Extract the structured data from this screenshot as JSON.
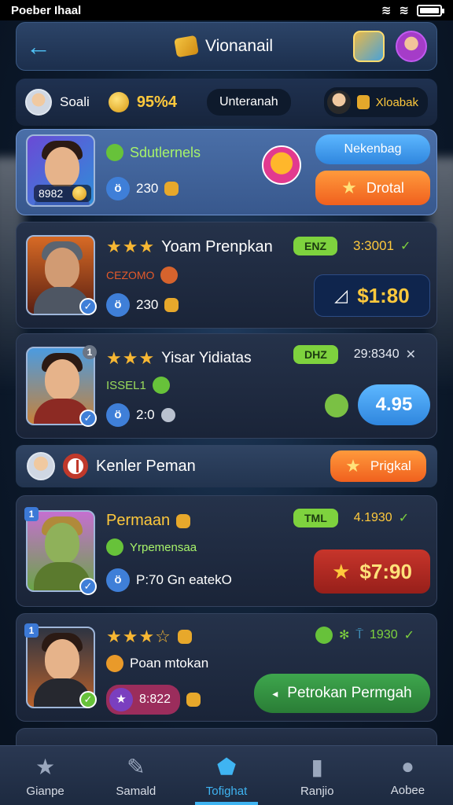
{
  "status_bar": {
    "carrier": "Poeber Ihaal"
  },
  "header": {
    "title": "Vionanail"
  },
  "filter_row": {
    "label": "Soali",
    "score": "95%4",
    "tab": "Unteranah",
    "user_label": "Xloabak"
  },
  "featured": {
    "rating": "Sdutlernels",
    "count": "230",
    "id": "8982",
    "btn_top": "Nekenbag",
    "btn_bottom": "Drotal"
  },
  "cards": [
    {
      "stars": "★★★",
      "title": "Yoam Prenpkan",
      "tag": "ENZ",
      "meta": "3:3001",
      "sub": "CEZOMO",
      "count": "230",
      "price": "$1:80"
    },
    {
      "stars": "★★★",
      "title": "Yisar Yidiatas",
      "tag": "DHZ",
      "meta": "29:8340",
      "sub": "ISSEL1",
      "count": "2:0",
      "price": "4.95"
    }
  ],
  "divider": {
    "label": "Kenler Peman",
    "button": "Prigkal"
  },
  "card3": {
    "title": "Permaan",
    "tag": "TML",
    "meta": "4.1930",
    "sub": "Yrpemensaa",
    "info": "P:70 Gn eatekO",
    "price": "$7:90"
  },
  "card4": {
    "sub": "Poan mtokan",
    "meta": "1930",
    "count": "8:822",
    "button": "Petrokan Permgah"
  },
  "bottom_nav": [
    {
      "label": "Gianpe",
      "icon": "★"
    },
    {
      "label": "Samald",
      "icon": "✎"
    },
    {
      "label": "Tofighat",
      "icon": "⬟"
    },
    {
      "label": "Ranjio",
      "icon": "▮"
    },
    {
      "label": "Aobee",
      "icon": "●"
    }
  ],
  "colors": {
    "accent": "#3fb4f2",
    "gold": "#ffc93c",
    "green": "#7ed23e",
    "orange": "#f0601e"
  }
}
